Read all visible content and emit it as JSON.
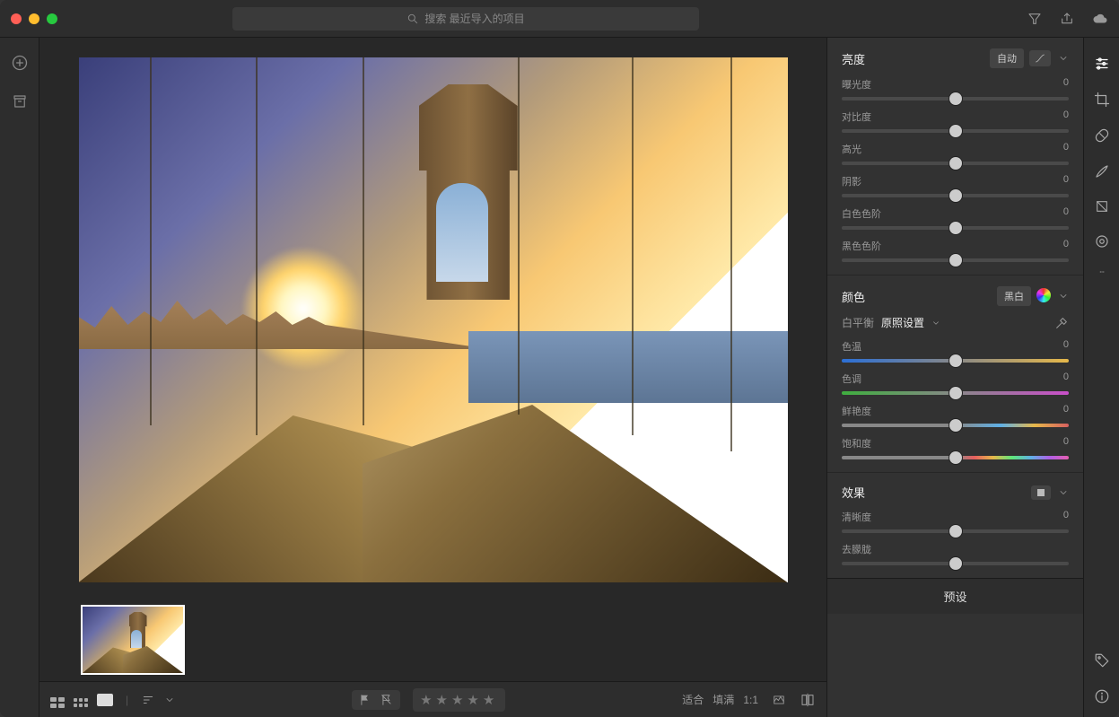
{
  "search": {
    "placeholder": "搜索 最近导入的项目"
  },
  "panels": {
    "light": {
      "title": "亮度",
      "auto": "自动",
      "sliders": [
        {
          "label": "曝光度",
          "value": "0",
          "pos": 50
        },
        {
          "label": "对比度",
          "value": "0",
          "pos": 50
        },
        {
          "label": "高光",
          "value": "0",
          "pos": 50
        },
        {
          "label": "阴影",
          "value": "0",
          "pos": 50
        },
        {
          "label": "白色色阶",
          "value": "0",
          "pos": 50
        },
        {
          "label": "黑色色阶",
          "value": "0",
          "pos": 50
        }
      ]
    },
    "color": {
      "title": "颜色",
      "bw": "黑白",
      "wb_label": "白平衡",
      "wb_value": "原照设置",
      "sliders": [
        {
          "label": "色温",
          "value": "0",
          "pos": 50,
          "grad": "temp-grad"
        },
        {
          "label": "色调",
          "value": "0",
          "pos": 50,
          "grad": "tint-grad"
        },
        {
          "label": "鲜艳度",
          "value": "0",
          "pos": 50,
          "grad": "vib-grad"
        },
        {
          "label": "饱和度",
          "value": "0",
          "pos": 50,
          "grad": "sat-grad"
        }
      ]
    },
    "effects": {
      "title": "效果",
      "sliders": [
        {
          "label": "清晰度",
          "value": "0",
          "pos": 50
        },
        {
          "label": "去朦胧",
          "value": "",
          "pos": 50
        }
      ]
    }
  },
  "toolbar": {
    "fit": "适合",
    "fill": "填满",
    "one_to_one": "1:1"
  },
  "presets_label": "预设"
}
